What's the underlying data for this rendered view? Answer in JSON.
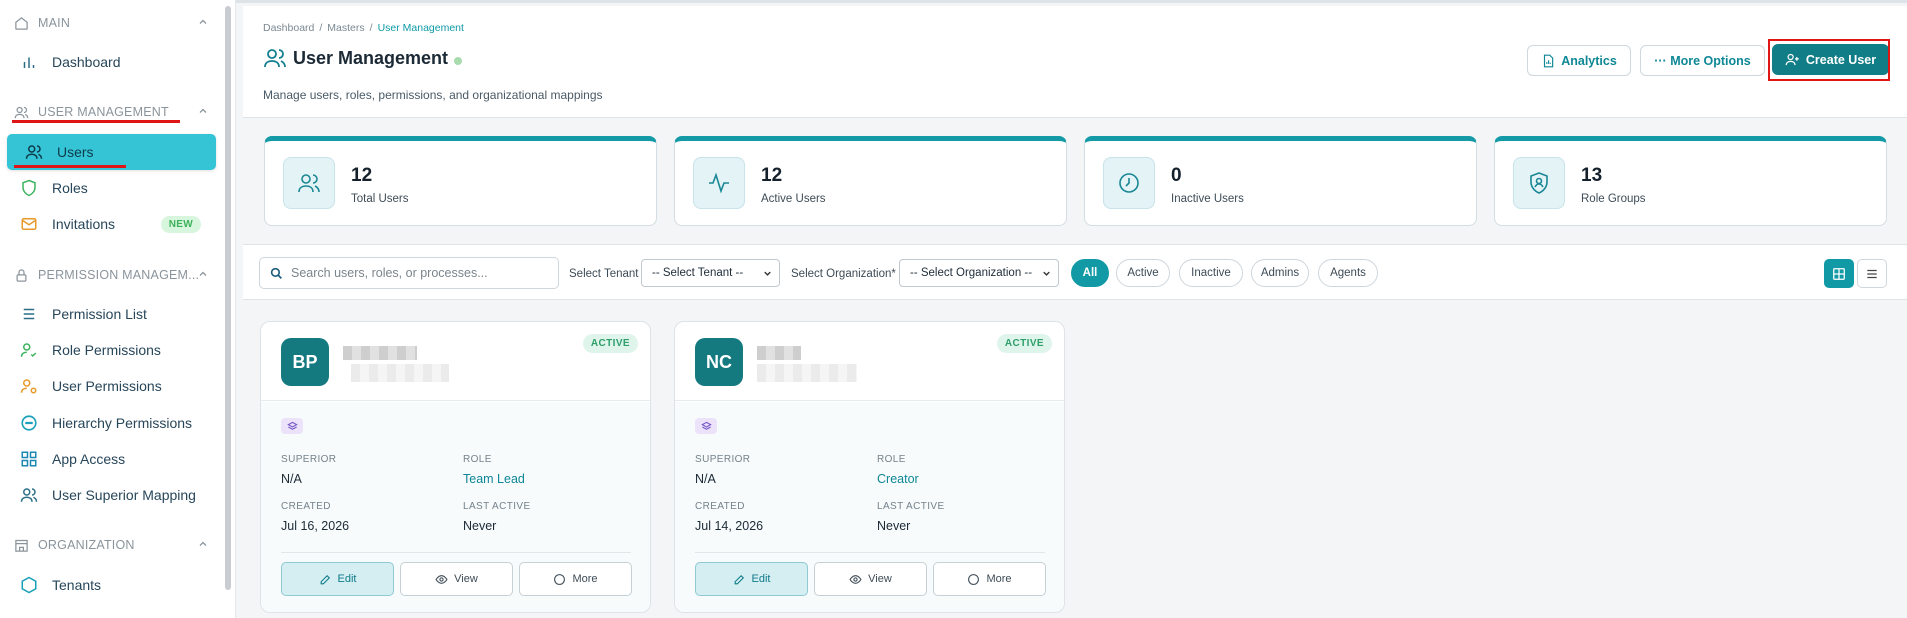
{
  "sidebar": {
    "sections": {
      "main": "MAIN",
      "user_management": "USER MANAGEMENT",
      "permission_management": "PERMISSION MANAGEM...",
      "organization": "ORGANIZATION"
    },
    "items": {
      "dashboard": "Dashboard",
      "users": "Users",
      "roles": "Roles",
      "invitations": "Invitations",
      "invitations_badge": "NEW",
      "permission_list": "Permission List",
      "role_permissions": "Role Permissions",
      "user_permissions": "User Permissions",
      "hierarchy_permissions": "Hierarchy Permissions",
      "app_access": "App Access",
      "user_superior_mapping": "User Superior Mapping",
      "tenants": "Tenants"
    }
  },
  "header": {
    "breadcrumb": [
      "Dashboard",
      "/",
      "Masters",
      "/",
      "User Management"
    ],
    "title": "User Management",
    "subtitle": "Manage users, roles, permissions, and organizational mappings",
    "analytics_label": "Analytics",
    "more_options_label": "··· More Options",
    "create_user_label": "Create User"
  },
  "stats": [
    {
      "value": "12",
      "label": "Total Users",
      "icon": "users-icon"
    },
    {
      "value": "12",
      "label": "Active Users",
      "icon": "activity-icon"
    },
    {
      "value": "0",
      "label": "Inactive Users",
      "icon": "clock-icon"
    },
    {
      "value": "13",
      "label": "Role Groups",
      "icon": "shield-user-icon"
    }
  ],
  "filters": {
    "search_placeholder": "Search users, roles, or processes...",
    "tenant_label": "Select Tenant",
    "tenant_value": "-- Select Tenant --",
    "org_label": "Select Organization*",
    "org_value": "-- Select Organization --",
    "pills": [
      "All",
      "Active",
      "Inactive",
      "Admins",
      "Agents"
    ],
    "active_pill": "All",
    "view_mode": "grid"
  },
  "users": [
    {
      "initials": "BP",
      "status": "ACTIVE",
      "superior_label": "SUPERIOR",
      "superior": "N/A",
      "role_label": "ROLE",
      "role": "Team Lead",
      "created_label": "CREATED",
      "created": "Jul 16, 2026",
      "last_active_label": "LAST ACTIVE",
      "last_active": "Never",
      "edit": "Edit",
      "view": "View",
      "more": "More"
    },
    {
      "initials": "NC",
      "status": "ACTIVE",
      "superior_label": "SUPERIOR",
      "superior": "N/A",
      "role_label": "ROLE",
      "role": "Creator",
      "created_label": "CREATED",
      "created": "Jul 14, 2026",
      "last_active_label": "LAST ACTIVE",
      "last_active": "Never",
      "edit": "Edit",
      "view": "View",
      "more": "More"
    }
  ],
  "colors": {
    "accent": "#119aa6",
    "sidebar_active": "#35c4d6",
    "primary_button": "#117d86",
    "annotation_red": "#e01616"
  }
}
